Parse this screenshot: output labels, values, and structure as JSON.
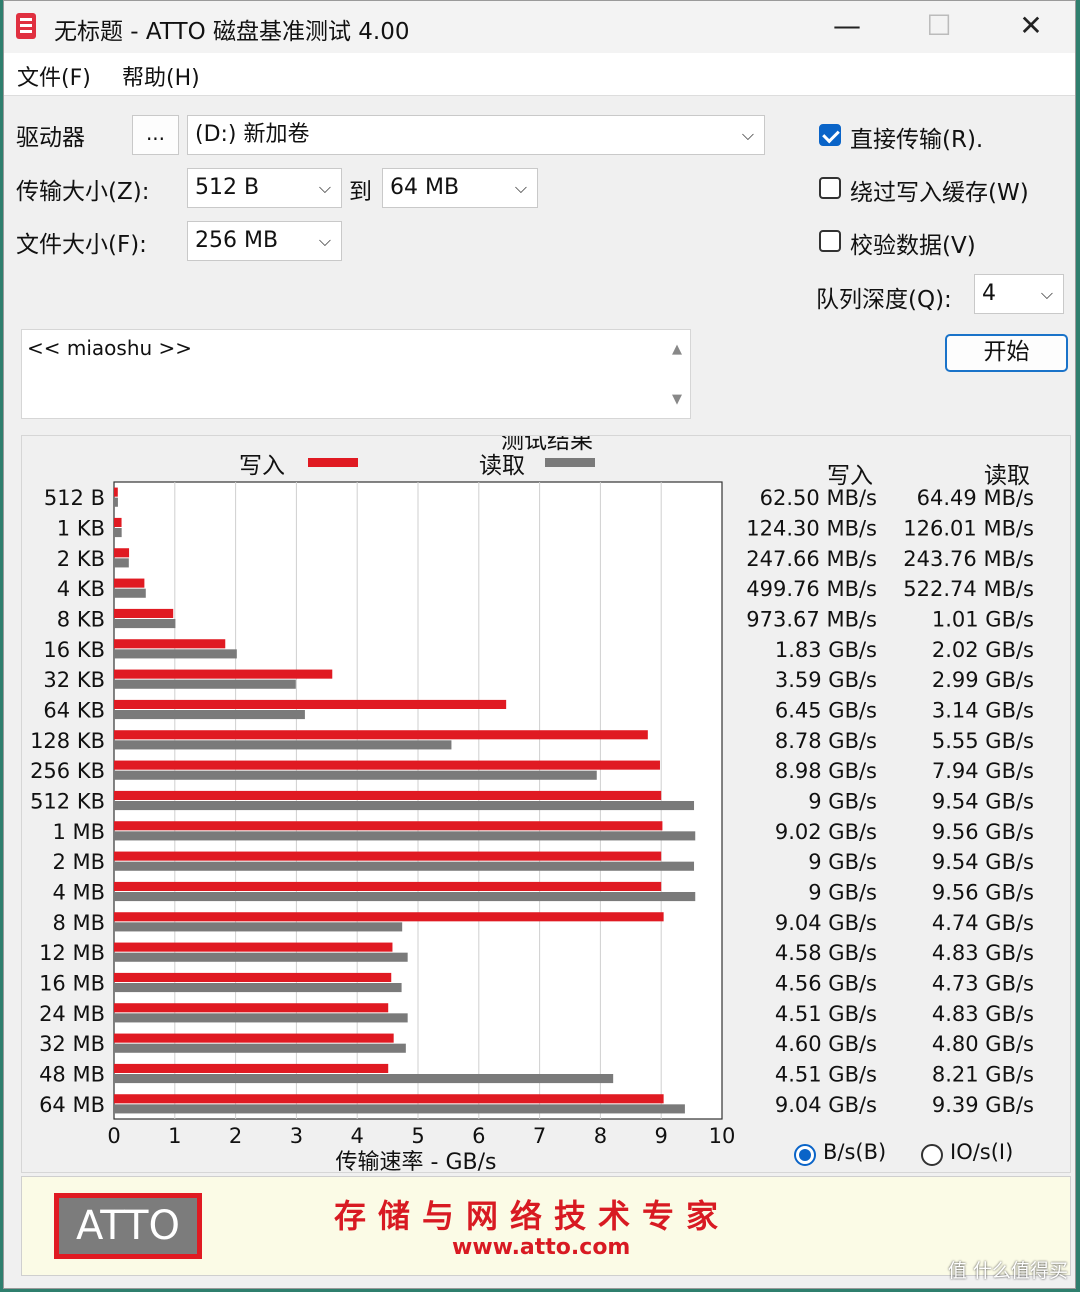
{
  "window": {
    "title": "无标题 - ATTO 磁盘基准测试 4.00",
    "minimize_glyph": "—",
    "maximize_glyph": "☐",
    "close_glyph": "✕"
  },
  "menu": {
    "file": "文件(F)",
    "help": "帮助(H)"
  },
  "form": {
    "drive_label": "驱动器",
    "browse_label": "...",
    "drive_value": "(D:) 新加卷",
    "transfer_size_label": "传输大小(Z):",
    "transfer_from": "512 B",
    "to_label": "到",
    "transfer_to": "64 MB",
    "file_size_label": "文件大小(F):",
    "file_size": "256 MB",
    "direct_io_label": "直接传输(R).",
    "direct_io_checked": true,
    "bypass_cache_label": "绕过写入缓存(W)",
    "bypass_cache_checked": false,
    "verify_label": "校验数据(V)",
    "verify_checked": false,
    "queue_depth_label": "队列深度(Q):",
    "queue_depth": "4",
    "start_label": "开始",
    "description": "<< miaoshu >>",
    "chevron": "⌵"
  },
  "results": {
    "title": "测试结果",
    "write_col": "写入",
    "read_col": "读取",
    "rows": [
      {
        "size": "512 B",
        "write": "62.50 MB/s",
        "read": "64.49 MB/s"
      },
      {
        "size": "1 KB",
        "write": "124.30 MB/s",
        "read": "126.01 MB/s"
      },
      {
        "size": "2 KB",
        "write": "247.66 MB/s",
        "read": "243.76 MB/s"
      },
      {
        "size": "4 KB",
        "write": "499.76 MB/s",
        "read": "522.74 MB/s"
      },
      {
        "size": "8 KB",
        "write": "973.67 MB/s",
        "read": "1.01 GB/s"
      },
      {
        "size": "16 KB",
        "write": "1.83 GB/s",
        "read": "2.02 GB/s"
      },
      {
        "size": "32 KB",
        "write": "3.59 GB/s",
        "read": "2.99 GB/s"
      },
      {
        "size": "64 KB",
        "write": "6.45 GB/s",
        "read": "3.14 GB/s"
      },
      {
        "size": "128 KB",
        "write": "8.78 GB/s",
        "read": "5.55 GB/s"
      },
      {
        "size": "256 KB",
        "write": "8.98 GB/s",
        "read": "7.94 GB/s"
      },
      {
        "size": "512 KB",
        "write": "9 GB/s",
        "read": "9.54 GB/s"
      },
      {
        "size": "1 MB",
        "write": "9.02 GB/s",
        "read": "9.56 GB/s"
      },
      {
        "size": "2 MB",
        "write": "9 GB/s",
        "read": "9.54 GB/s"
      },
      {
        "size": "4 MB",
        "write": "9 GB/s",
        "read": "9.56 GB/s"
      },
      {
        "size": "8 MB",
        "write": "9.04 GB/s",
        "read": "4.74 GB/s"
      },
      {
        "size": "12 MB",
        "write": "4.58 GB/s",
        "read": "4.83 GB/s"
      },
      {
        "size": "16 MB",
        "write": "4.56 GB/s",
        "read": "4.73 GB/s"
      },
      {
        "size": "24 MB",
        "write": "4.51 GB/s",
        "read": "4.83 GB/s"
      },
      {
        "size": "32 MB",
        "write": "4.60 GB/s",
        "read": "4.80 GB/s"
      },
      {
        "size": "48 MB",
        "write": "4.51 GB/s",
        "read": "8.21 GB/s"
      },
      {
        "size": "64 MB",
        "write": "9.04 GB/s",
        "read": "9.39 GB/s"
      }
    ],
    "unit_bytes_label": "B/s(B)",
    "unit_bytes_selected": true,
    "unit_io_label": "IO/s(I)",
    "unit_io_selected": false
  },
  "chart_data": {
    "type": "bar",
    "orientation": "horizontal",
    "categories": [
      "512 B",
      "1 KB",
      "2 KB",
      "4 KB",
      "8 KB",
      "16 KB",
      "32 KB",
      "64 KB",
      "128 KB",
      "256 KB",
      "512 KB",
      "1 MB",
      "2 MB",
      "4 MB",
      "8 MB",
      "12 MB",
      "16 MB",
      "24 MB",
      "32 MB",
      "48 MB",
      "64 MB"
    ],
    "series": [
      {
        "name": "写入",
        "color": "#e01a22",
        "values": [
          0.0625,
          0.1243,
          0.2477,
          0.4998,
          0.9737,
          1.83,
          3.59,
          6.45,
          8.78,
          8.98,
          9.0,
          9.02,
          9.0,
          9.0,
          9.04,
          4.58,
          4.56,
          4.51,
          4.6,
          4.51,
          9.04
        ]
      },
      {
        "name": "读取",
        "color": "#7a7a7a",
        "values": [
          0.0645,
          0.126,
          0.2438,
          0.5227,
          1.01,
          2.02,
          2.99,
          3.14,
          5.55,
          7.94,
          9.54,
          9.56,
          9.54,
          9.56,
          4.74,
          4.83,
          4.73,
          4.83,
          4.8,
          8.21,
          9.39
        ]
      }
    ],
    "title": "测试结果",
    "xlabel": "传输速率 - GB/s",
    "ylabel": "",
    "xlim": [
      0,
      10
    ],
    "xticks": [
      "0",
      "1",
      "2",
      "3",
      "4",
      "5",
      "6",
      "7",
      "8",
      "9",
      "10"
    ],
    "grid": true,
    "legend_position": "top"
  },
  "banner": {
    "logo_text": "ATTO",
    "slogan": "存储与网络技术专家",
    "url": "www.atto.com"
  },
  "watermark": "值 什么值得买"
}
